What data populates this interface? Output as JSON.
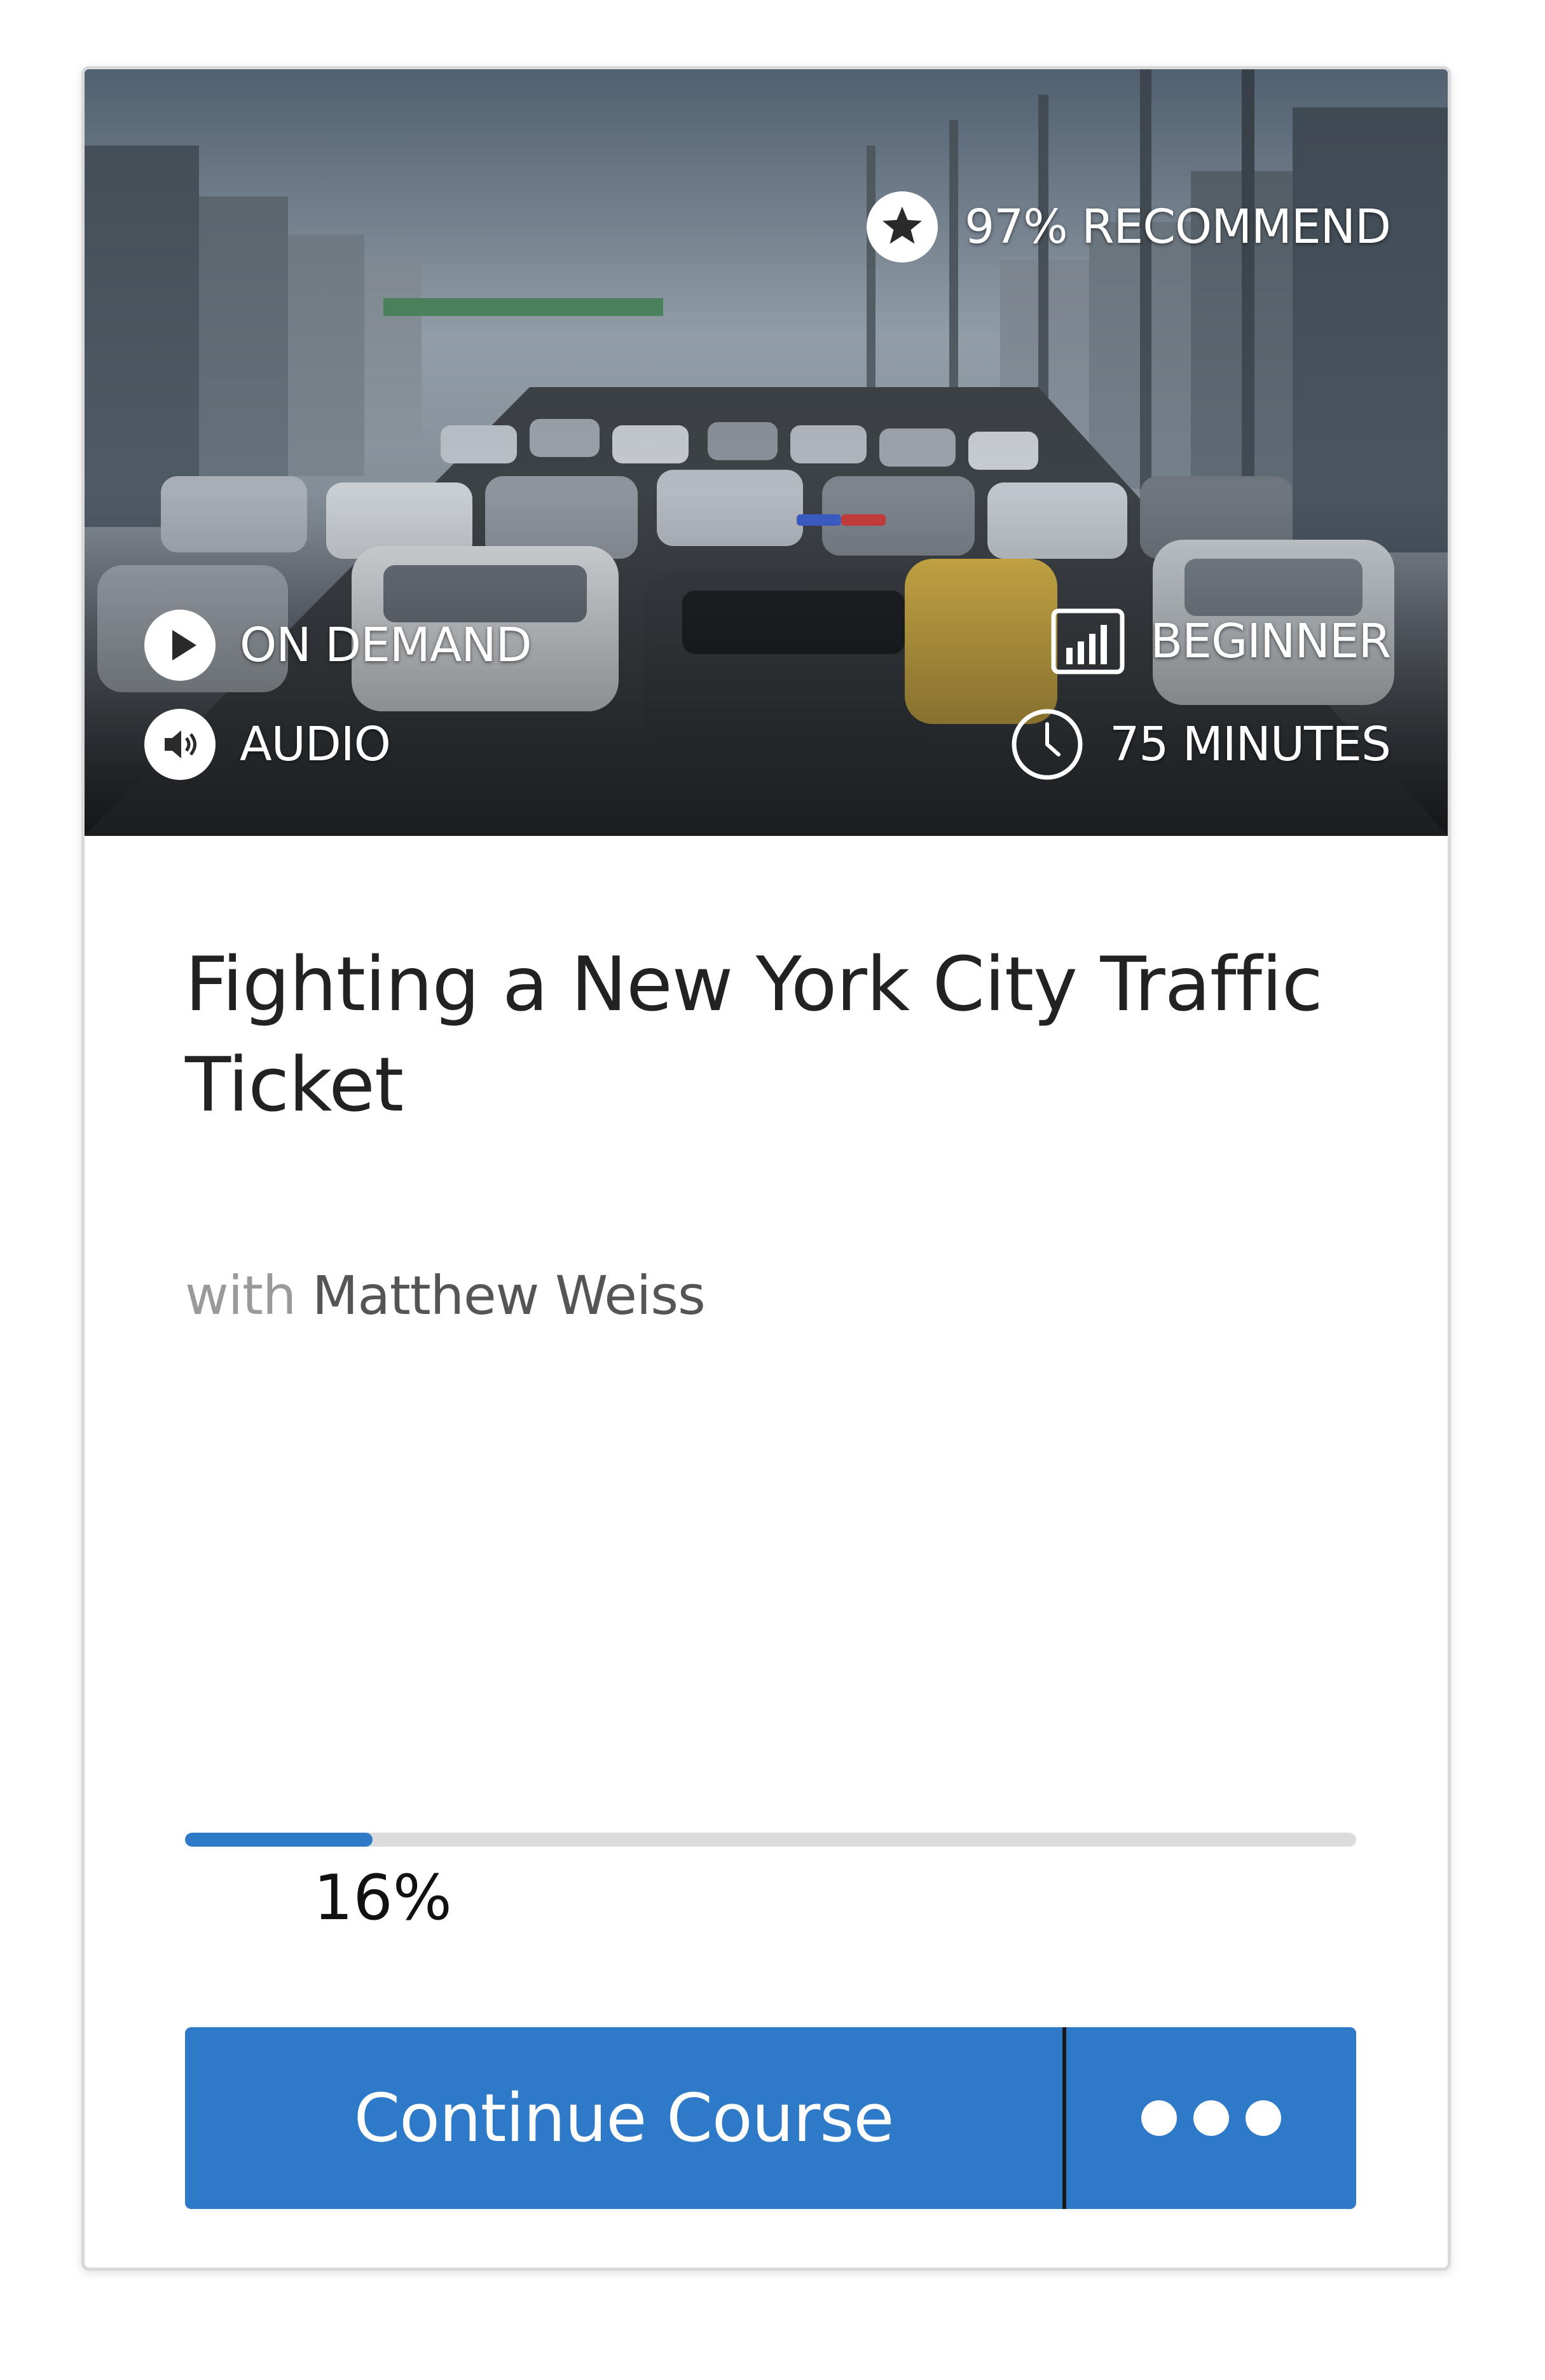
{
  "course": {
    "recommend": "97% RECOMMEND",
    "format": "ON DEMAND",
    "media": "AUDIO",
    "level": "BEGINNER",
    "duration": "75 MINUTES",
    "title": "Fighting a New York City Traffic Ticket",
    "byline_prefix": "with",
    "instructor": "Matthew Weiss",
    "hero_image": "city traffic street with cars and police"
  },
  "progress": {
    "percent": 16,
    "label": "16%"
  },
  "actions": {
    "continue_label": "Continue Course",
    "more_icon": "ellipsis-icon"
  },
  "icons": {
    "recommend": "star-circle-icon",
    "format": "play-circle-icon",
    "media": "speaker-circle-icon",
    "level": "bar-chart-icon",
    "duration": "clock-icon"
  },
  "colors": {
    "accent": "#2f7ac8",
    "progress_track": "#dcdcdc",
    "title_text": "#222222",
    "byline_text": "#9a9a9a"
  }
}
